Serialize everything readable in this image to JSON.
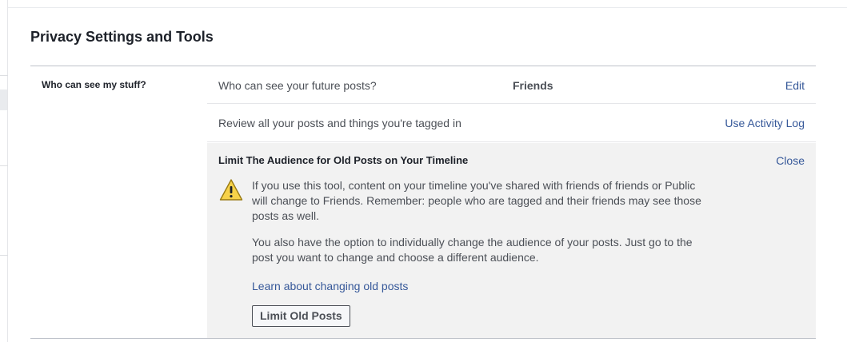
{
  "page": {
    "title": "Privacy Settings and Tools"
  },
  "section": {
    "label": "Who can see my stuff?"
  },
  "rows": [
    {
      "description": "Who can see your future posts?",
      "value": "Friends",
      "action": "Edit"
    },
    {
      "description": "Review all your posts and things you're tagged in",
      "action": "Use Activity Log"
    }
  ],
  "expanded": {
    "heading": "Limit The Audience for Old Posts on Your Timeline",
    "close_label": "Close",
    "icon": "warning-icon",
    "paragraph_1": "If you use this tool, content on your timeline you've shared with friends of friends or Public will change to Friends. Remember: people who are tagged and their friends may see those posts as well.",
    "paragraph_2": "You also have the option to individually change the audience of your posts. Just go to the post you want to change and choose a different audience.",
    "learn_link": "Learn about changing old posts",
    "button_label": "Limit Old Posts"
  },
  "colors": {
    "link": "#365899",
    "warning_fill": "#f7d24a",
    "panel_bg": "#f2f2f2"
  }
}
